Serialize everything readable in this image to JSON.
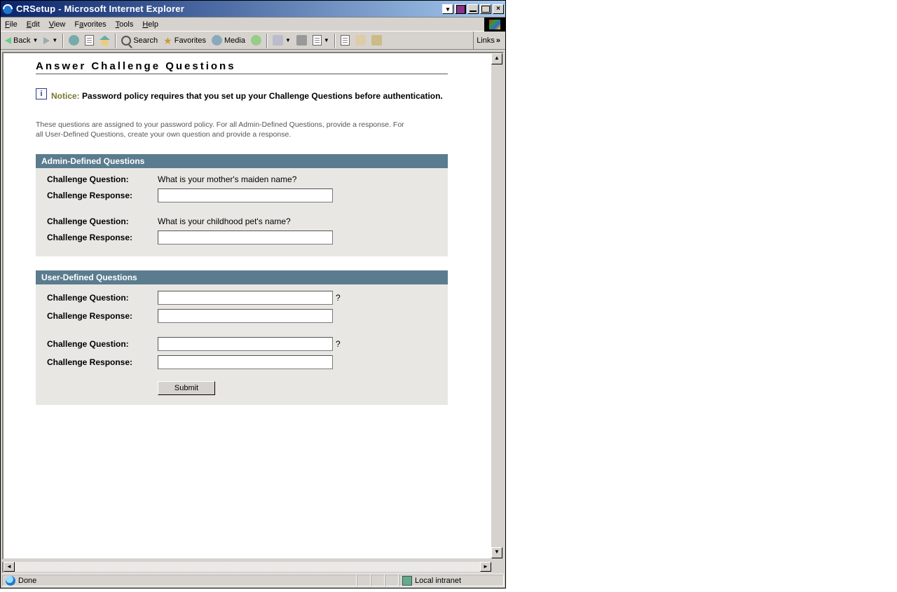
{
  "window": {
    "title": "CRSetup - Microsoft Internet Explorer"
  },
  "menus": {
    "file": "File",
    "edit": "Edit",
    "view": "View",
    "favorites": "Favorites",
    "tools": "Tools",
    "help": "Help"
  },
  "toolbar": {
    "back": "Back",
    "search": "Search",
    "favorites": "Favorites",
    "media": "Media",
    "links": "Links"
  },
  "status": {
    "left": "Done",
    "zone": "Local intranet"
  },
  "page": {
    "title": "Answer Challenge Questions",
    "notice_label": "Notice:",
    "notice_text": "Password policy requires that you set up your Challenge Questions before authentication.",
    "desc": "These questions are assigned to your password policy. For all Admin-Defined Questions, provide a response. For all User-Defined Questions, create your own question and provide a response.",
    "admin_header": "Admin-Defined Questions",
    "user_header": "User-Defined Questions",
    "cq_label": "Challenge Question:",
    "cr_label": "Challenge Response:",
    "admin_questions": [
      "What is your mother's maiden name?",
      "What is your childhood pet's name?"
    ],
    "qmark": "?",
    "submit": "Submit"
  }
}
